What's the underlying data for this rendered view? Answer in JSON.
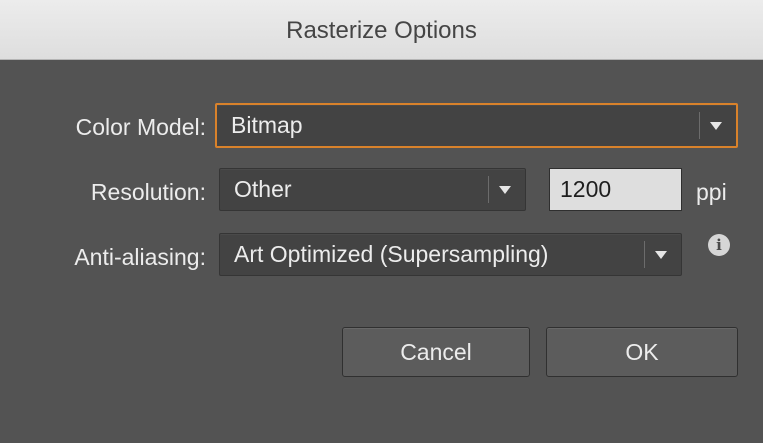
{
  "dialog": {
    "title": "Rasterize Options"
  },
  "color_model": {
    "label": "Color Model:",
    "value": "Bitmap"
  },
  "resolution": {
    "label": "Resolution:",
    "value": "Other",
    "ppi_value": "1200",
    "unit": "ppi"
  },
  "anti_aliasing": {
    "label": "Anti-aliasing:",
    "value": "Art Optimized (Supersampling)",
    "info_icon": "info-icon",
    "info_glyph": "i"
  },
  "buttons": {
    "cancel": "Cancel",
    "ok": "OK"
  },
  "colors": {
    "focus_ring": "#d9822b",
    "dialog_bg": "#535353"
  }
}
